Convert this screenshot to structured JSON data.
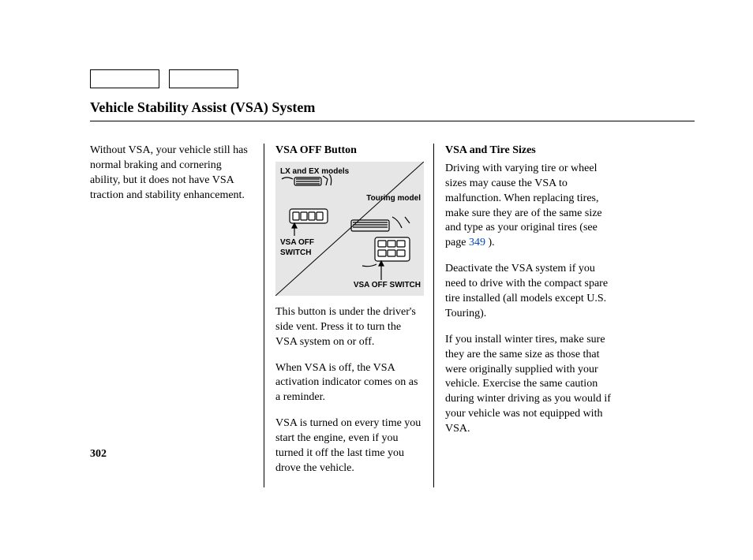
{
  "title": "Vehicle Stability Assist (VSA) System",
  "page_number": "302",
  "col1": {
    "p1": "Without VSA, your vehicle still has normal braking and cornering ability, but it does not have VSA traction and stability enhancement."
  },
  "col2": {
    "heading": "VSA OFF Button",
    "diagram": {
      "label_lx": "LX and EX models",
      "label_touring": "Touring model",
      "label_switch_left": "VSA OFF SWITCH",
      "label_switch_right": "VSA OFF SWITCH"
    },
    "p1": "This button is under the driver's side vent. Press it to turn the VSA system on or off.",
    "p2": "When VSA is off, the VSA activation indicator comes on as a reminder.",
    "p3": "VSA is turned on every time you start the engine, even if you turned it off the last time you drove the vehicle."
  },
  "col3": {
    "heading": "VSA and Tire Sizes",
    "p1_pre": "Driving with varying tire or wheel sizes may cause the VSA to malfunction. When replacing tires, make sure they are of the same size and type as your original tires (see page ",
    "p1_link": "349",
    "p1_post": " ).",
    "p2": "Deactivate the VSA system if you need to drive with the compact spare tire installed (all models except U.S. Touring).",
    "p3": "If you install winter tires, make sure they are the same size as those that were originally supplied with your vehicle. Exercise the same caution during winter driving as you would if your vehicle was not equipped with VSA."
  }
}
